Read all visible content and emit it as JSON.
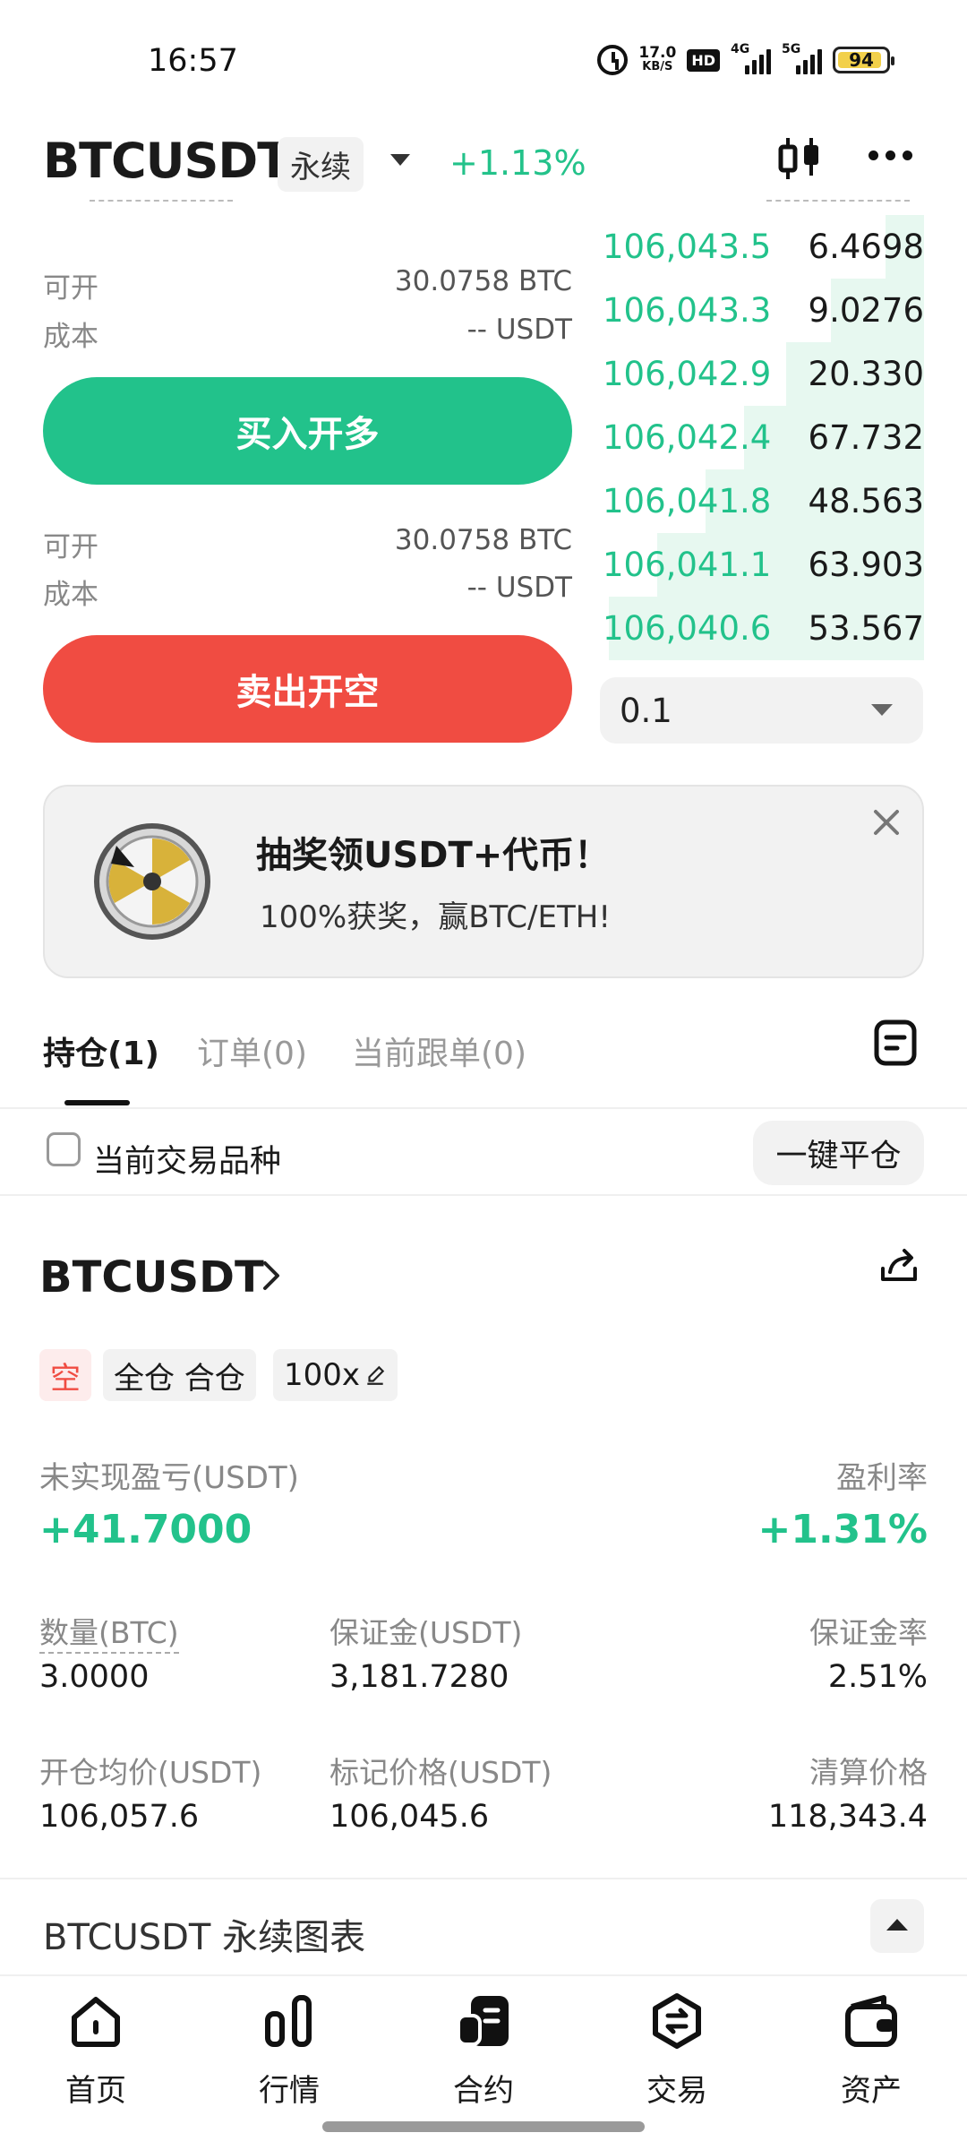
{
  "status_bar": {
    "time": "16:57",
    "net_speed_value": "17.0",
    "net_speed_unit": "KB/S",
    "hd_label": "HD",
    "signal1_label": "4G",
    "signal2_label": "5G",
    "battery": "94",
    "icons": [
      "alarm-icon",
      "hd-icon",
      "signal-icon",
      "battery-icon"
    ]
  },
  "header": {
    "symbol": "BTCUSDT",
    "contract_type": "永续",
    "change": "+1.13%",
    "change_color": "#23c28a"
  },
  "order_panel": {
    "long": {
      "available_label": "可开",
      "available_value": "30.0758 BTC",
      "cost_label": "成本",
      "cost_value": "-- USDT",
      "button_label": "买入开多",
      "button_color": "#22c28b"
    },
    "short": {
      "available_label": "可开",
      "available_value": "30.0758 BTC",
      "cost_label": "成本",
      "cost_value": "-- USDT",
      "button_label": "卖出开空",
      "button_color": "#f04c42"
    }
  },
  "order_book": {
    "rows": [
      {
        "price": "106,043.5",
        "qty": "6.4698",
        "depth": 0.12
      },
      {
        "price": "106,043.3",
        "qty": "9.0276",
        "depth": 0.29
      },
      {
        "price": "106,042.9",
        "qty": "20.330",
        "depth": 0.43
      },
      {
        "price": "106,042.4",
        "qty": "67.732",
        "depth": 0.56
      },
      {
        "price": "106,041.8",
        "qty": "48.563",
        "depth": 0.68
      },
      {
        "price": "106,041.1",
        "qty": "63.903",
        "depth": 0.83
      },
      {
        "price": "106,040.6",
        "qty": "53.567",
        "depth": 0.98
      }
    ],
    "quantity_select": "0.1"
  },
  "promo": {
    "title": "抽奖领USDT+代币！",
    "subtitle": "100%获奖，赢BTC/ETH!"
  },
  "tabs": [
    {
      "label": "持仓(1)",
      "active": true
    },
    {
      "label": "订单(0)",
      "active": false
    },
    {
      "label": "当前跟单(0)",
      "active": false
    }
  ],
  "filter": {
    "label": "当前交易品种",
    "close_all": "一键平仓"
  },
  "position": {
    "symbol": "BTCUSDT",
    "side": "空",
    "margin_mode": "全仓 合仓",
    "leverage": "100x",
    "unrealized_pnl_label": "未实现盈亏(USDT)",
    "unrealized_pnl": "+41.7000",
    "roe_label": "盈利率",
    "roe": "+1.31%",
    "stats": [
      {
        "label": "数量(BTC)",
        "value": "3.0000"
      },
      {
        "label": "保证金(USDT)",
        "value": "3,181.7280"
      },
      {
        "label": "保证金率",
        "value": "2.51%"
      },
      {
        "label": "开仓均价(USDT)",
        "value": "106,057.6"
      },
      {
        "label": "标记价格(USDT)",
        "value": "106,045.6"
      },
      {
        "label": "清算价格",
        "value": "118,343.4"
      }
    ]
  },
  "chart_section": {
    "title": "BTCUSDT 永续图表"
  },
  "bottom_nav": [
    {
      "label": "首页",
      "icon": "home-icon"
    },
    {
      "label": "行情",
      "icon": "market-icon"
    },
    {
      "label": "合约",
      "icon": "contract-icon",
      "active": true
    },
    {
      "label": "交易",
      "icon": "trade-icon"
    },
    {
      "label": "资产",
      "icon": "wallet-icon"
    }
  ]
}
